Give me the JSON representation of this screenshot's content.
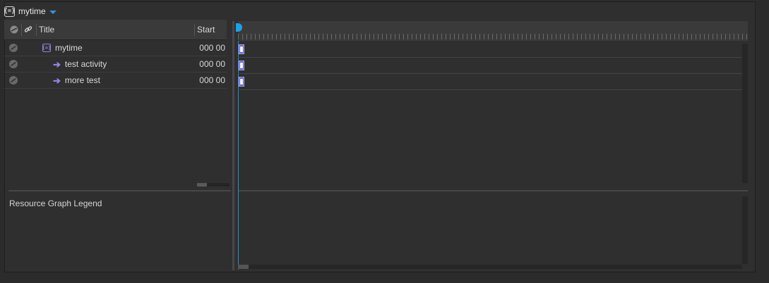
{
  "header": {
    "project_icon": "project-bracket-icon",
    "title": "mytime",
    "dropdown_icon": "chevron-down-icon",
    "accent": "#3b8fd9"
  },
  "table": {
    "columns": [
      {
        "icon": "status-icon"
      },
      {
        "icon": "link-icon"
      },
      {
        "label": "Title"
      },
      {
        "label": "Start"
      }
    ],
    "rows": [
      {
        "type": "project",
        "title": "mytime",
        "start": "000 00"
      },
      {
        "type": "activity",
        "title": "test activity",
        "start": "000 00"
      },
      {
        "type": "activity",
        "title": "more test",
        "start": "000 00"
      }
    ]
  },
  "resource_graph": {
    "label": "Resource Graph Legend"
  },
  "colors": {
    "playhead": "#1aa3e8",
    "bar_fill": "#6d64c8",
    "icon_purple": "#8c84d8"
  }
}
